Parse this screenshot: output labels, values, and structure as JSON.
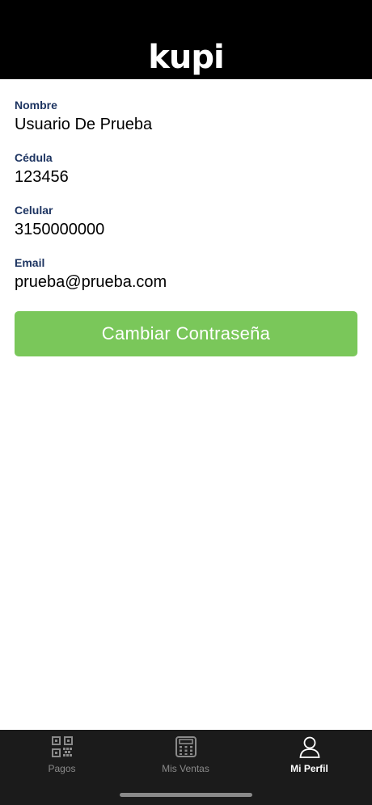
{
  "header": {
    "logo_text": "kupi"
  },
  "profile": {
    "fields": [
      {
        "label": "Nombre",
        "value": "Usuario De Prueba"
      },
      {
        "label": "Cédula",
        "value": "123456"
      },
      {
        "label": "Celular",
        "value": "3150000000"
      },
      {
        "label": "Email",
        "value": "prueba@prueba.com"
      }
    ],
    "change_password_label": "Cambiar Contraseña"
  },
  "tabbar": {
    "active": "Mi Perfil",
    "tabs": [
      {
        "label": "Pagos",
        "icon": "qr-code-icon"
      },
      {
        "label": "Mis Ventas",
        "icon": "calculator-icon"
      },
      {
        "label": "Mi Perfil",
        "icon": "user-icon"
      }
    ]
  },
  "colors": {
    "header_bg": "#000000",
    "label": "#1d3461",
    "button": "#7ac75a",
    "tabbar_bg": "#1b1b1b",
    "tab_inactive": "#8a8a8a",
    "tab_active": "#ffffff"
  }
}
